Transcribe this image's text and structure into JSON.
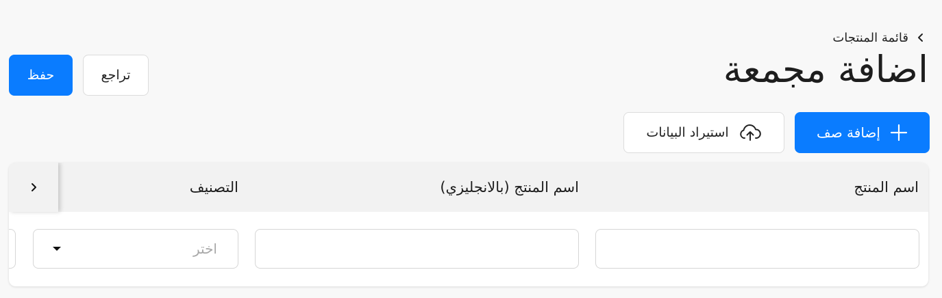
{
  "breadcrumb": {
    "label": "قائمة المنتجات",
    "icon": "chevron-left-icon"
  },
  "header": {
    "title": "اضافة مجمعة",
    "save_label": "حفظ",
    "undo_label": "تراجع"
  },
  "toolbar": {
    "add_row_label": "إضافة صف",
    "add_row_icon": "plus-icon",
    "import_label": "استيراد البيانات",
    "import_icon": "cloud-upload-icon"
  },
  "table": {
    "columns": [
      "اسم المنتج",
      "اسم المنتج (بالانجليزي)",
      "التصنيف"
    ],
    "row": {
      "name": "",
      "name_en": "",
      "category_placeholder": "اختر"
    },
    "scroll_icon": "chevron-right-icon"
  },
  "colors": {
    "accent": "#0a7cff",
    "background": "#f8f8f8",
    "header_bg": "#f2f2f2"
  }
}
